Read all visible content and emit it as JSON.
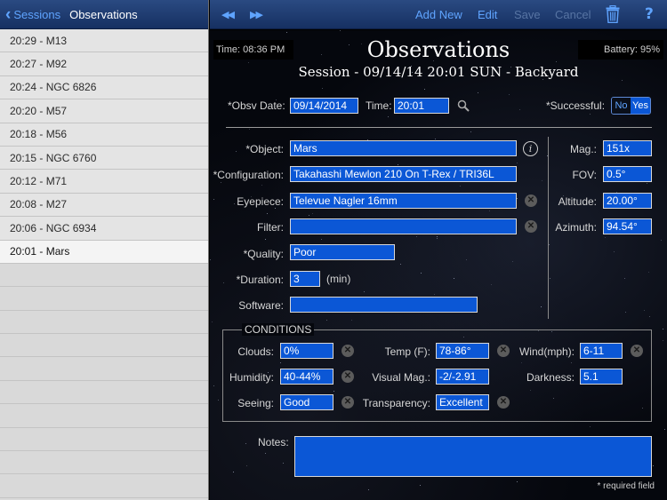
{
  "sidebar": {
    "back_label": "Sessions",
    "title": "Observations",
    "items": [
      {
        "label": "20:29 - M13"
      },
      {
        "label": "20:27 - M92"
      },
      {
        "label": "20:24 - NGC 6826"
      },
      {
        "label": "20:20 - M57"
      },
      {
        "label": "20:18 - M56"
      },
      {
        "label": "20:15 - NGC 6760"
      },
      {
        "label": "20:12 - M71"
      },
      {
        "label": "20:08 - M27"
      },
      {
        "label": "20:06 - NGC 6934"
      },
      {
        "label": "20:01 - Mars"
      }
    ],
    "selected_index": 9
  },
  "toolbar": {
    "prev_icon": "rewind-icon",
    "next_icon": "fast-forward-icon",
    "add_new": "Add New",
    "edit": "Edit",
    "save": "Save",
    "cancel": "Cancel",
    "trash_icon": "trash-icon",
    "help": "?"
  },
  "header": {
    "time": "Time: 08:36 PM",
    "battery": "Battery: 95%",
    "title": "Observations",
    "subtitle": "Session - 09/14/14 20:01 SUN - Backyard"
  },
  "form": {
    "obsv_date_label": "*Obsv Date:",
    "obsv_date": "09/14/2014",
    "time_label": "Time:",
    "time": "20:01",
    "successful_label": "*Successful:",
    "successful_no": "No",
    "successful_yes": "Yes",
    "successful_value": "Yes",
    "object_label": "*Object:",
    "object": "Mars",
    "configuration_label": "*Configuration:",
    "configuration": "Takahashi Mewlon 210 On T-Rex / TRI36L",
    "eyepiece_label": "Eyepiece:",
    "eyepiece": "Televue Nagler 16mm",
    "filter_label": "Filter:",
    "filter": "",
    "quality_label": "*Quality:",
    "quality": "Poor",
    "duration_label": "*Duration:",
    "duration": "3",
    "duration_unit": "(min)",
    "software_label": "Software:",
    "software": "",
    "mag_label": "Mag.:",
    "mag": "151x",
    "fov_label": "FOV:",
    "fov": "0.5°",
    "altitude_label": "Altitude:",
    "altitude": "20.00°",
    "azimuth_label": "Azimuth:",
    "azimuth": "94.54°"
  },
  "conditions": {
    "title": "CONDITIONS",
    "clouds_label": "Clouds:",
    "clouds": "0%",
    "temp_label": "Temp (F):",
    "temp": "78-86°",
    "wind_label": "Wind(mph):",
    "wind": "6-11",
    "humidity_label": "Humidity:",
    "humidity": "40-44%",
    "visual_mag_label": "Visual Mag.:",
    "visual_mag": "-2/-2.91",
    "darkness_label": "Darkness:",
    "darkness": "5.1",
    "seeing_label": "Seeing:",
    "seeing": "Good",
    "transparency_label": "Transparency:",
    "transparency": "Excellent"
  },
  "notes": {
    "label": "Notes:",
    "value": "",
    "required_note": "* required field"
  },
  "colors": {
    "field_blue": "#0b57d6",
    "toolbar_blue": "#1e3c72",
    "link_blue": "#5fa4ff",
    "sidebar_bg": "#d9d9d9"
  }
}
